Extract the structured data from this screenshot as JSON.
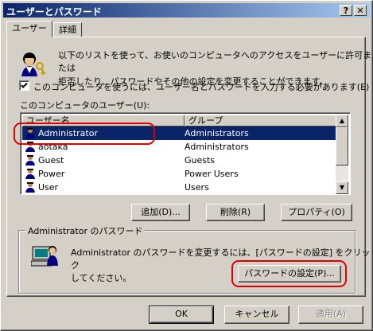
{
  "window": {
    "title": "ユーザーとパスワード",
    "help_button": "?",
    "close_button": "✕"
  },
  "tabs": [
    {
      "label": "ユーザー"
    },
    {
      "label": "詳細"
    }
  ],
  "intro": {
    "text_line1": "以下のリストを使って、お使いのコンピュータへのアクセスをユーザーに許可または",
    "text_line2": "拒否したり、パスワードやその他の設定を変更することができます。"
  },
  "require_login": {
    "checked": true,
    "label": "このコンピュータを使うには、ユーザー名とパスワードを入力する必要があります(E)"
  },
  "users_list": {
    "label": "このコンピュータのユーザー(U):",
    "columns": [
      "ユーザー名",
      "グループ"
    ],
    "rows": [
      {
        "name": "Administrator",
        "group": "Administrators",
        "selected": true
      },
      {
        "name": "aotaka",
        "group": "Administrators",
        "selected": false
      },
      {
        "name": "Guest",
        "group": "Guests",
        "selected": false
      },
      {
        "name": "Power",
        "group": "Power Users",
        "selected": false
      },
      {
        "name": "User",
        "group": "Users",
        "selected": false
      }
    ]
  },
  "list_buttons": {
    "add": "追加(D)...",
    "remove": "削除(R)",
    "properties": "プロパティ(O)"
  },
  "password_group": {
    "title": "Administrator のパスワード",
    "text_line1": "Administrator のパスワードを変更するには、[パスワードの設定] をクリック",
    "text_line2": "してください。",
    "set_password_button": "パスワードの設定(P)..."
  },
  "footer_buttons": {
    "ok": "OK",
    "cancel": "キャンセル",
    "apply": "適用(A)"
  },
  "colors": {
    "title_gradient_start": "#0a246a",
    "title_gradient_end": "#a6caf0",
    "selection": "#0a246a",
    "face": "#d4d0c8",
    "annotation_red": "#e00000"
  }
}
